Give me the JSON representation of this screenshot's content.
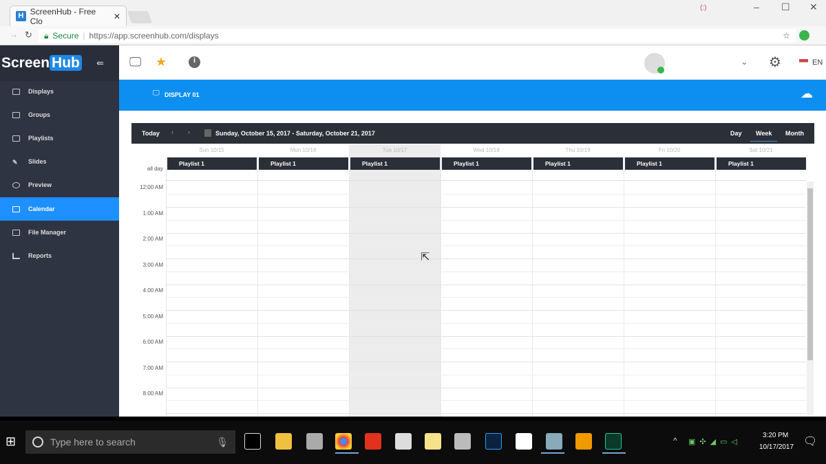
{
  "browser": {
    "tab_title": "ScreenHub - Free Clo",
    "tab_favicon": "H",
    "secure_label": "Secure",
    "url": "https://app.screenhub.com/displays"
  },
  "app": {
    "logo_left": "Screen",
    "logo_right": "Hub",
    "lang": "EN"
  },
  "sidebar": {
    "items": [
      {
        "label": "Displays"
      },
      {
        "label": "Groups"
      },
      {
        "label": "Playlists"
      },
      {
        "label": "Slides"
      },
      {
        "label": "Preview"
      },
      {
        "label": "Calendar",
        "active": true
      },
      {
        "label": "File Manager"
      },
      {
        "label": "Reports"
      }
    ]
  },
  "bluebar": {
    "title": "DISPLAY 01"
  },
  "calendar": {
    "today": "Today",
    "prev": "‹",
    "next": "›",
    "range": "Sunday, October 15, 2017 - Saturday, October 21, 2017",
    "views": [
      "Day",
      "Week",
      "Month"
    ],
    "active_view": "Week",
    "days": [
      "Sun 10/15",
      "Mon 10/16",
      "Tue 10/17",
      "Wed 10/18",
      "Thu 10/19",
      "Fri 10/20",
      "Sat 10/21"
    ],
    "allday_label": "all day",
    "event": "Playlist 1",
    "times": [
      "12:00 AM",
      "1:00 AM",
      "2:00 AM",
      "3:00 AM",
      "4:00 AM",
      "5:00 AM",
      "6:00 AM",
      "7:00 AM",
      "8:00 AM"
    ]
  },
  "taskbar": {
    "search_placeholder": "Type here to search",
    "time": "3:20 PM",
    "date": "10/17/2017"
  },
  "colors": {
    "accent": "#0d8ff2",
    "sidebar": "#2f3442",
    "toolbar": "#2b2f37"
  }
}
